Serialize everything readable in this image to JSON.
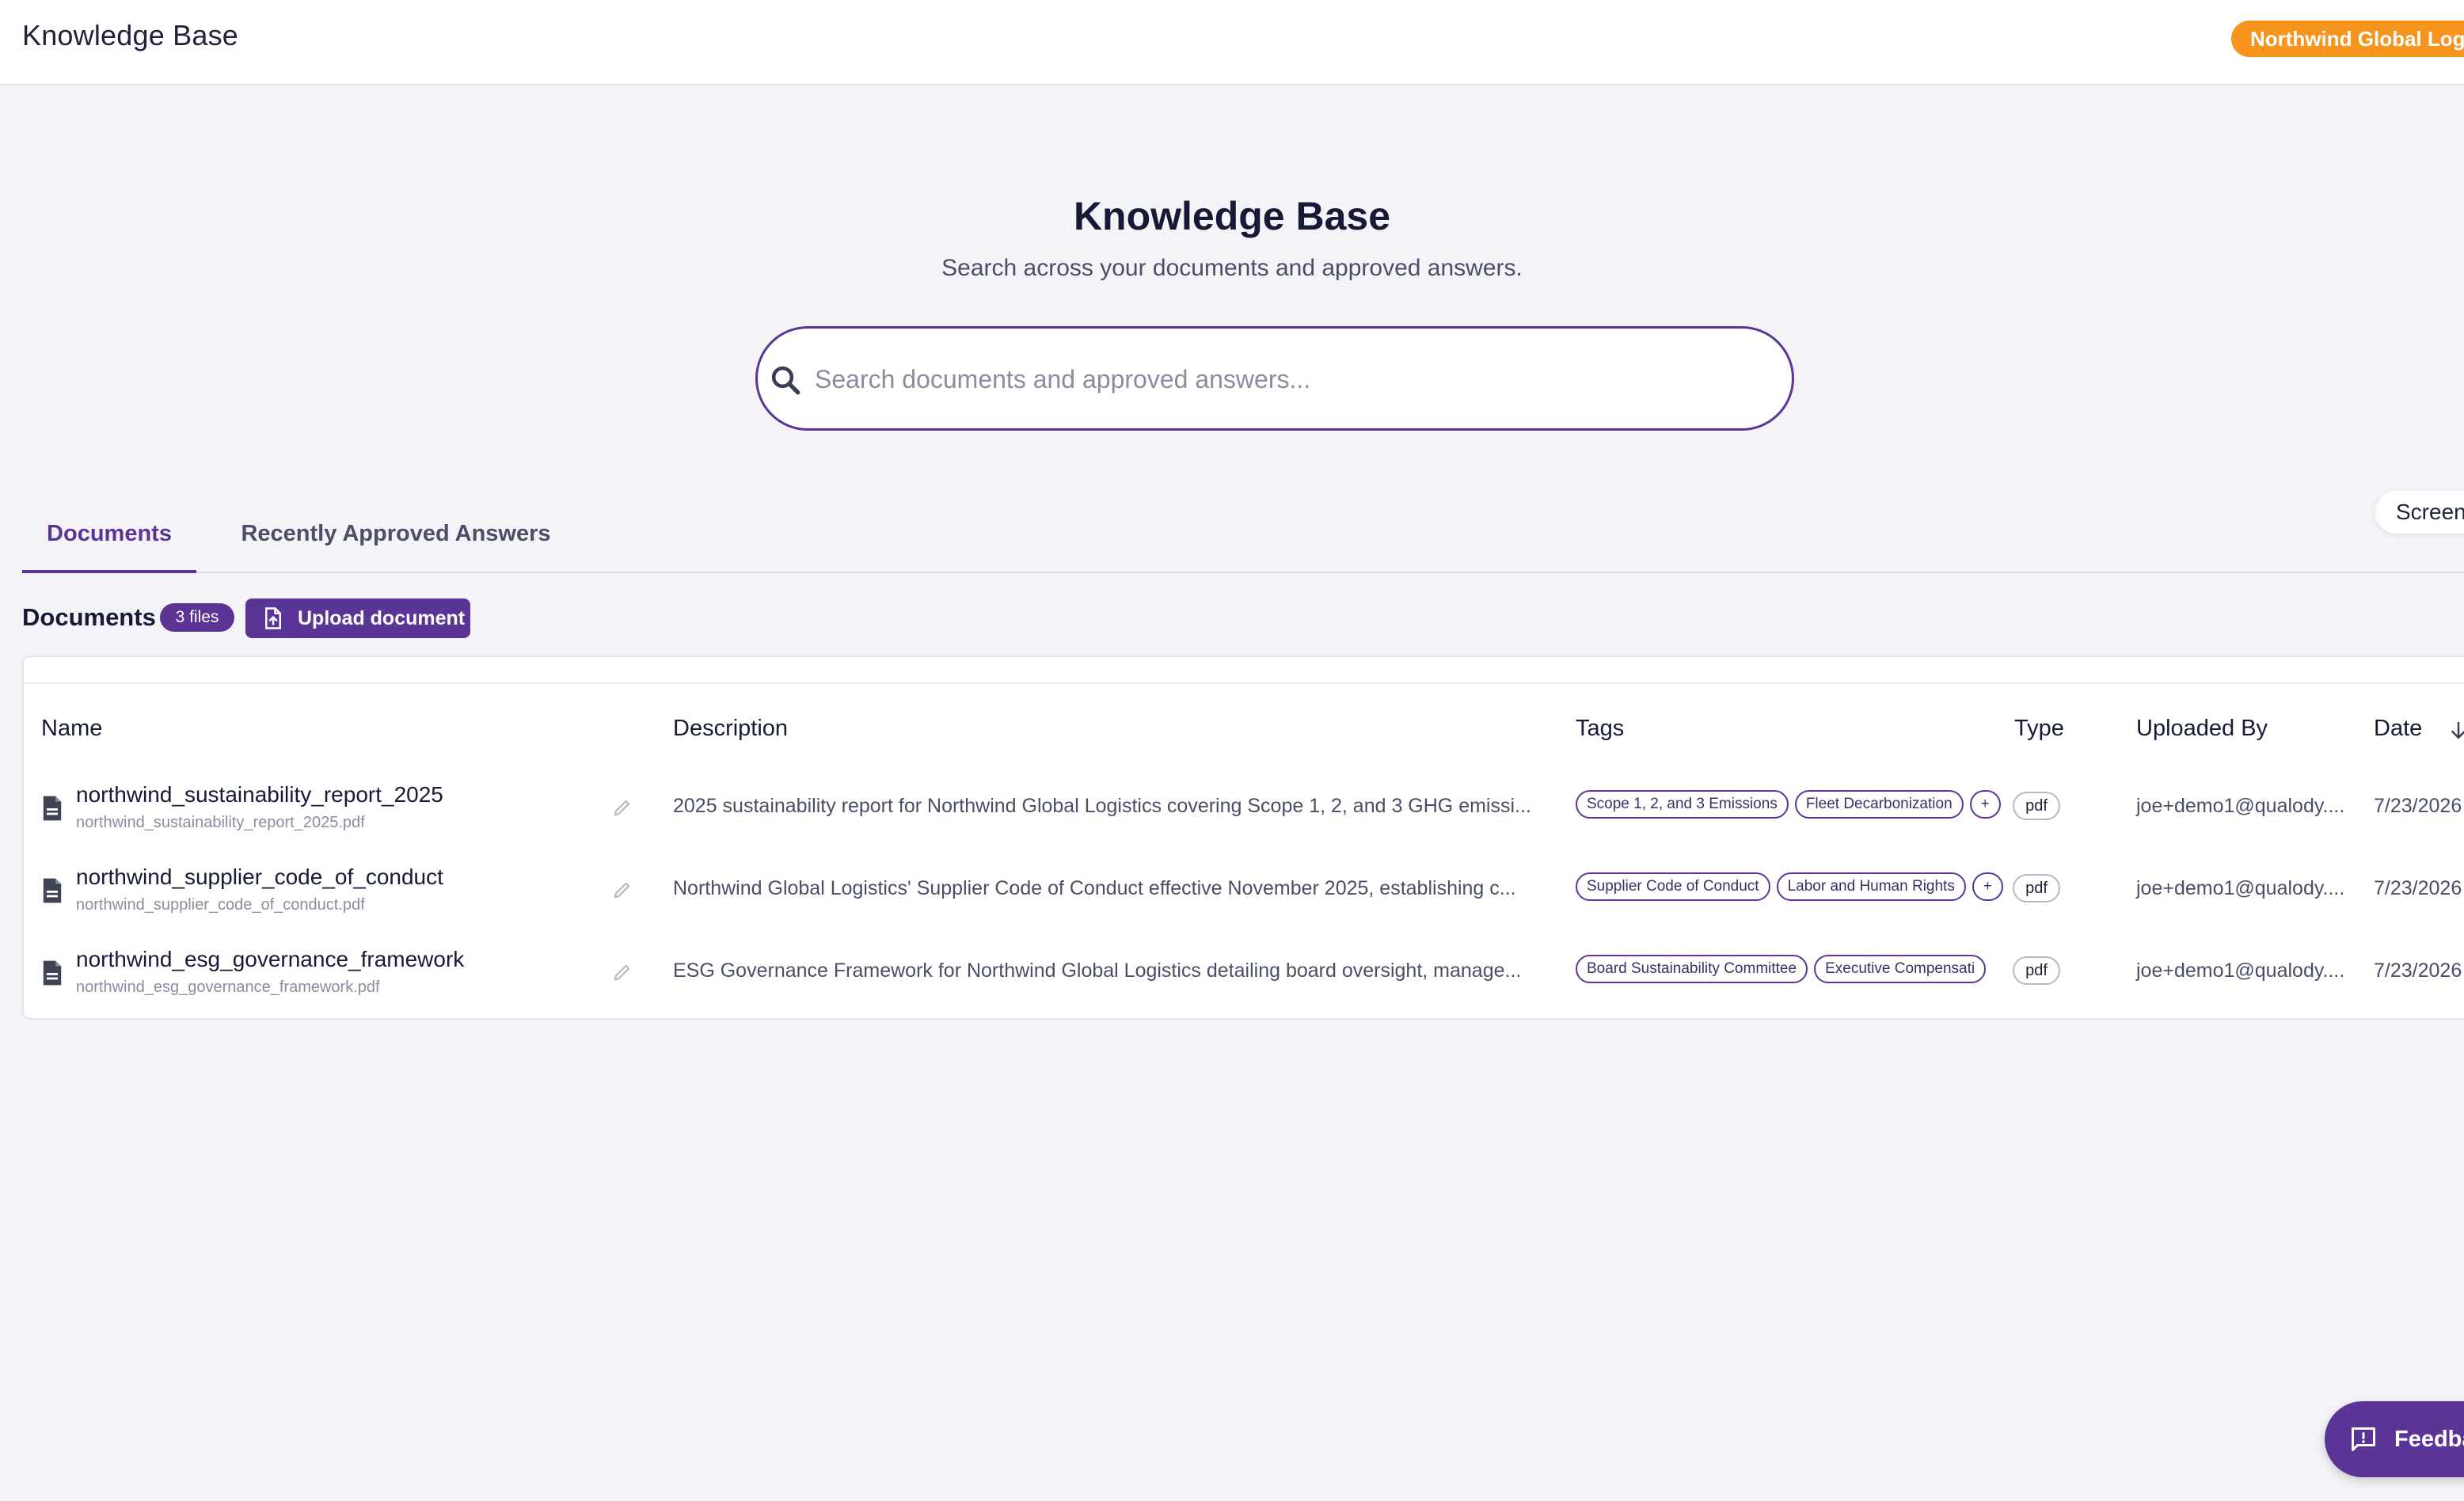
{
  "header": {
    "app_title": "Knowledge Base",
    "org_name": "Northwind Global Logistics"
  },
  "hero": {
    "title": "Knowledge Base",
    "subtitle": "Search across your documents and approved answers.",
    "search_placeholder": "Search documents and approved answers...",
    "search_value": ""
  },
  "tabs": [
    {
      "label": "Documents",
      "active": true
    },
    {
      "label": "Recently Approved Answers",
      "active": false
    }
  ],
  "screen_pill_label": "Screen",
  "documents": {
    "label": "Documents",
    "count_badge": "3 files",
    "upload_label": "Upload document",
    "columns": {
      "name": "Name",
      "description": "Description",
      "tags": "Tags",
      "type": "Type",
      "uploaded_by": "Uploaded By",
      "date": "Date"
    },
    "sort": {
      "column": "date",
      "direction": "descending"
    },
    "rows": [
      {
        "name": "northwind_sustainability_report_2025",
        "filename": "northwind_sustainability_report_2025.pdf",
        "description": "2025 sustainability report for Northwind Global Logistics covering Scope 1, 2, and 3 GHG emissi...",
        "tags": [
          "Scope 1, 2, and 3 Emissions",
          "Fleet Decarbonization"
        ],
        "type": "pdf",
        "uploaded_by": "joe+demo1@qualody....",
        "date": "7/23/2026"
      },
      {
        "name": "northwind_supplier_code_of_conduct",
        "filename": "northwind_supplier_code_of_conduct.pdf",
        "description": "Northwind Global Logistics' Supplier Code of Conduct effective November 2025, establishing c...",
        "tags": [
          "Supplier Code of Conduct",
          "Labor and Human Rights"
        ],
        "type": "pdf",
        "uploaded_by": "joe+demo1@qualody....",
        "date": "7/23/2026"
      },
      {
        "name": "northwind_esg_governance_framework",
        "filename": "northwind_esg_governance_framework.pdf",
        "description": "ESG Governance Framework for Northwind Global Logistics detailing board oversight, manage...",
        "tags": [
          "Board Sustainability Committee",
          "Executive Compensati"
        ],
        "type": "pdf",
        "uploaded_by": "joe+demo1@qualody....",
        "date": "7/23/2026"
      }
    ]
  },
  "feedback_label": "Feedba",
  "colors": {
    "brand_purple": "#5b3596",
    "org_badge_orange": "#f7941d",
    "page_background": "#f4f3f8"
  },
  "icons": {
    "search": "search-icon",
    "upload": "upload-file-icon",
    "file": "document-icon",
    "edit": "pencil-icon",
    "sort": "arrow-down-icon",
    "feedback": "feedback-icon"
  }
}
